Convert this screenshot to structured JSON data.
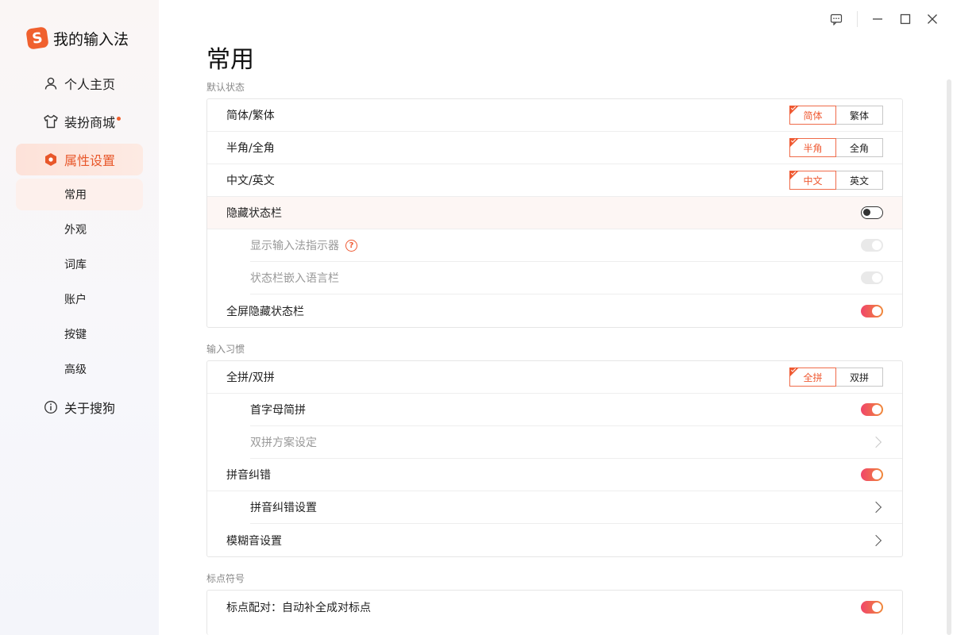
{
  "app": {
    "title": "我的输入法",
    "logo_letter": "S",
    "accent": "#f0602e"
  },
  "window_controls": [
    "feedback-icon",
    "minimize-icon",
    "maximize-icon",
    "close-icon"
  ],
  "sidebar": {
    "items": [
      {
        "label": "个人主页",
        "icon": "user-icon"
      },
      {
        "label": "装扮商城",
        "icon": "tshirt-icon",
        "badge": true
      },
      {
        "label": "属性设置",
        "icon": "hexagon-settings-icon",
        "active": true
      },
      {
        "label": "关于搜狗",
        "icon": "info-icon"
      }
    ],
    "sub_items": [
      "常用",
      "外观",
      "词库",
      "账户",
      "按键",
      "高级"
    ],
    "active_sub": "常用"
  },
  "main": {
    "title": "常用",
    "sections": [
      {
        "label": "默认状态",
        "rows": [
          {
            "label": "简体/繁体",
            "control": "segmented",
            "options": [
              "简体",
              "繁体"
            ],
            "selected": 0
          },
          {
            "label": "半角/全角",
            "control": "segmented",
            "options": [
              "半角",
              "全角"
            ],
            "selected": 0
          },
          {
            "label": "中文/英文",
            "control": "segmented",
            "options": [
              "中文",
              "英文"
            ],
            "selected": 0
          },
          {
            "label": "隐藏状态栏",
            "control": "toggle",
            "state": "off"
          },
          {
            "label": "显示输入法指示器",
            "control": "toggle",
            "state": "disabled",
            "indent": true,
            "help": "?"
          },
          {
            "label": "状态栏嵌入语言栏",
            "control": "toggle",
            "state": "disabled",
            "indent": true
          },
          {
            "label": "全屏隐藏状态栏",
            "control": "toggle",
            "state": "on"
          }
        ]
      },
      {
        "label": "输入习惯",
        "rows": [
          {
            "label": "全拼/双拼",
            "control": "segmented",
            "options": [
              "全拼",
              "双拼"
            ],
            "selected": 0
          },
          {
            "label": "首字母简拼",
            "control": "toggle",
            "state": "on",
            "indent": true
          },
          {
            "label": "双拼方案设定",
            "control": "chevron",
            "disabled": true,
            "indent": true
          },
          {
            "label": "拼音纠错",
            "control": "toggle",
            "state": "on"
          },
          {
            "label": "拼音纠错设置",
            "control": "chevron",
            "indent": true
          },
          {
            "label": "模糊音设置",
            "control": "chevron"
          }
        ]
      },
      {
        "label": "标点符号",
        "rows": [
          {
            "label": "标点配对：自动补全成对标点",
            "control": "toggle",
            "state": "on"
          }
        ]
      }
    ]
  }
}
